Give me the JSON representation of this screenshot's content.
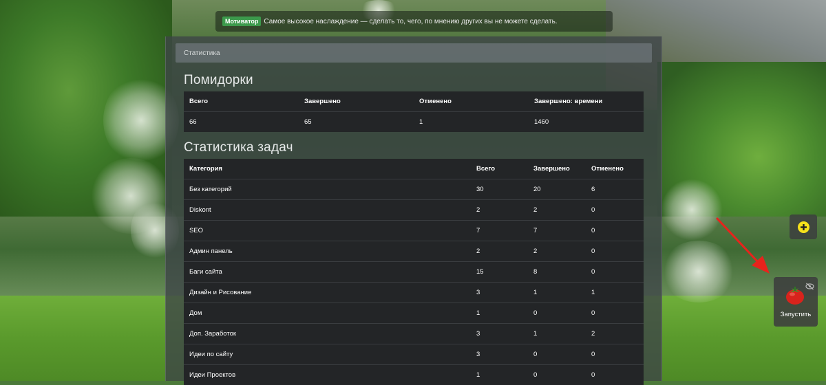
{
  "motivator": {
    "badge": "Мотиватор",
    "quote": "Самое высокое наслаждение — сделать то, чего, по мнению других вы не можете сделать."
  },
  "breadcrumb": {
    "label": "Статистика"
  },
  "pomodoros": {
    "title": "Помидорки",
    "headers": [
      "Всего",
      "Завершено",
      "Отменено",
      "Завершено: времени"
    ],
    "values": [
      "66",
      "65",
      "1",
      "1460"
    ]
  },
  "tasks": {
    "title": "Статистика задач",
    "headers": [
      "Категория",
      "Всего",
      "Завершено",
      "Отменено"
    ],
    "rows": [
      [
        "Без категорий",
        "30",
        "20",
        "6"
      ],
      [
        "Diskont",
        "2",
        "2",
        "0"
      ],
      [
        "SEO",
        "7",
        "7",
        "0"
      ],
      [
        "Админ панель",
        "2",
        "2",
        "0"
      ],
      [
        "Баги сайта",
        "15",
        "8",
        "0"
      ],
      [
        "Дизайн и Рисование",
        "3",
        "1",
        "1"
      ],
      [
        "Дом",
        "1",
        "0",
        "0"
      ],
      [
        "Доп. Заработок",
        "3",
        "1",
        "2"
      ],
      [
        "Идеи по сайту",
        "3",
        "0",
        "0"
      ],
      [
        "Идеи Проектов",
        "1",
        "0",
        "0"
      ]
    ]
  },
  "widgets": {
    "start_label": "Запустить",
    "add_icon": "plus-circle-icon",
    "tomato_icon": "tomato-icon",
    "hide_icon": "eye-slash-icon",
    "accent_yellow": "#f7e21b",
    "arrow_color": "#e8231c"
  }
}
